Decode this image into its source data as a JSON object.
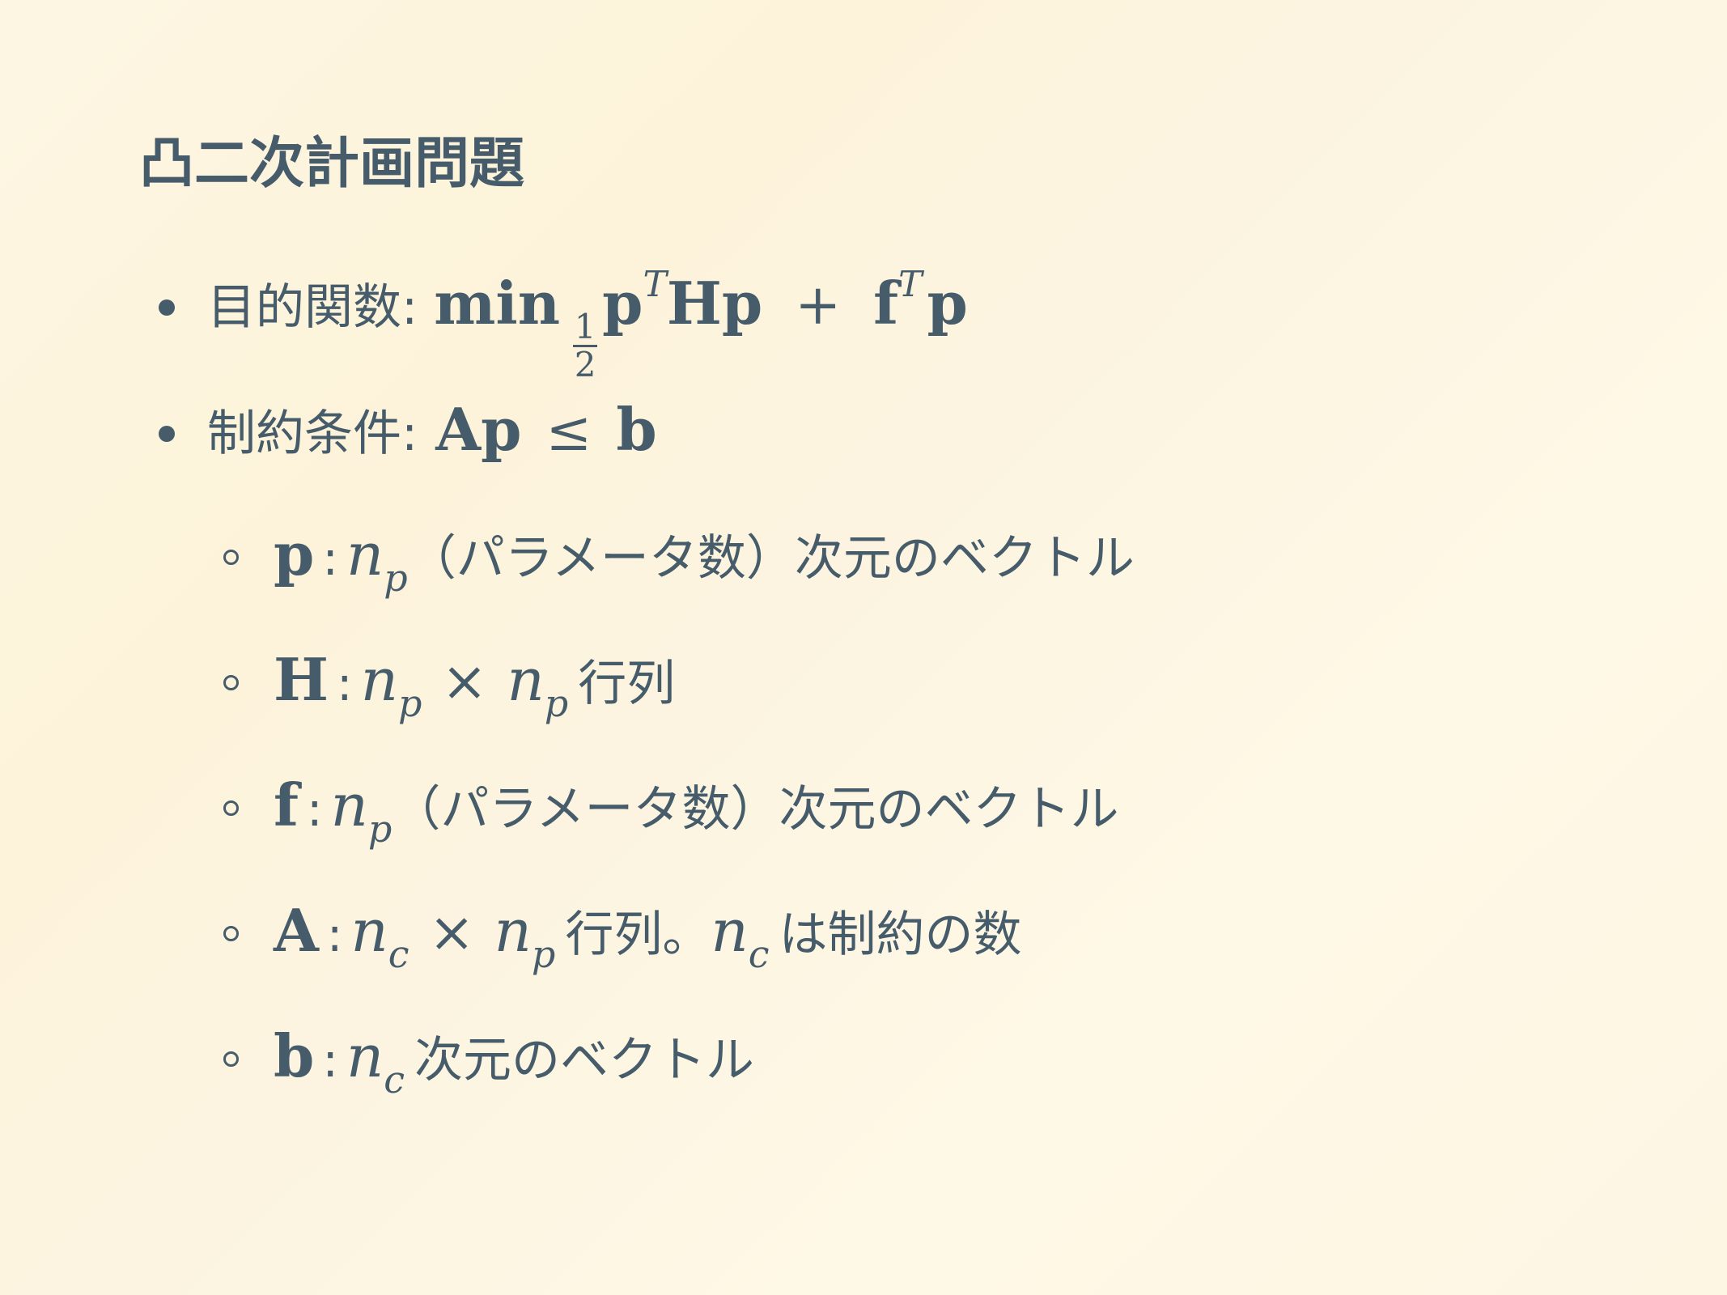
{
  "slide": {
    "title": "凸二次計画問題",
    "objective": {
      "label": "目的関数:",
      "min": "min",
      "frac_num": "1",
      "frac_den": "2",
      "p1": "p",
      "T1": "T",
      "H": "Hp",
      "plus": "+",
      "f": "f",
      "T2": "T",
      "p2": "p"
    },
    "constraint": {
      "label": "制約条件:",
      "Ap": "Ap",
      "leq": "≤",
      "b": "b"
    },
    "definitions": [
      {
        "sym": "p",
        "colon": ":",
        "n1": "n",
        "s1": "p",
        "times": "",
        "n2": "",
        "s2": "",
        "text": "（パラメータ数）次元のベクトル"
      },
      {
        "sym": "H",
        "colon": ":",
        "n1": "n",
        "s1": "p",
        "times": "×",
        "n2": "n",
        "s2": "p",
        "text": "行列"
      },
      {
        "sym": "f",
        "colon": ":",
        "n1": "n",
        "s1": "p",
        "times": "",
        "n2": "",
        "s2": "",
        "text": "（パラメータ数）次元のベクトル"
      },
      {
        "sym": "A",
        "colon": ":",
        "n1": "n",
        "s1": "c",
        "times": "×",
        "n2": "n",
        "s2": "p",
        "text": "行列。",
        "n3": "n",
        "s3": "c",
        "text2": "は制約の数"
      },
      {
        "sym": "b",
        "colon": ":",
        "n1": "n",
        "s1": "c",
        "times": "",
        "n2": "",
        "s2": "",
        "text": "次元のベクトル"
      }
    ]
  }
}
